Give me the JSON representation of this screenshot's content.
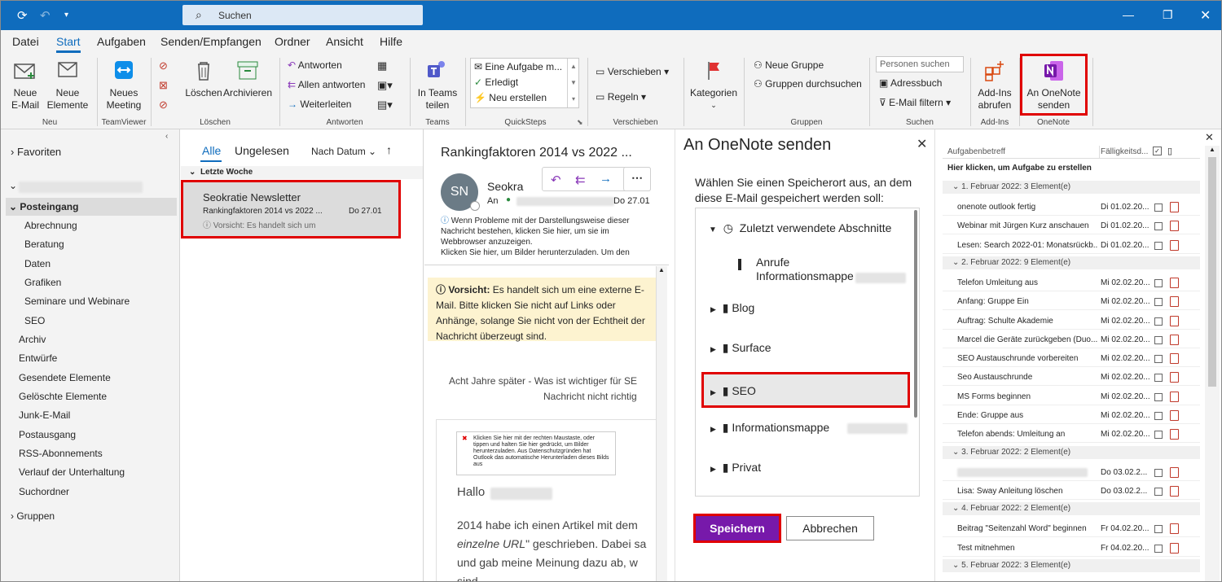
{
  "titlebar": {
    "search_placeholder": "Suchen"
  },
  "menu": {
    "tabs": [
      "Datei",
      "Start",
      "Aufgaben",
      "Senden/Empfangen",
      "Ordner",
      "Ansicht",
      "Hilfe"
    ]
  },
  "ribbon": {
    "neu": {
      "new_mail": "Neue\nE-Mail",
      "new_items": "Neue\nElemente",
      "label": "Neu"
    },
    "teamviewer": {
      "meeting": "Neues\nMeeting",
      "label": "TeamViewer"
    },
    "loeschen": {
      "delete": "Löschen",
      "archive": "Archivieren",
      "label": "Löschen"
    },
    "antworten": {
      "reply": "Antworten",
      "reply_all": "Allen antworten",
      "forward": "Weiterleiten",
      "label": "Antworten"
    },
    "teams": {
      "share": "In Teams\nteilen",
      "label": "Teams"
    },
    "quicksteps": {
      "items": [
        "Eine Aufgabe m...",
        "Erledigt",
        "Neu erstellen"
      ],
      "label": "QuickSteps"
    },
    "verschieben": {
      "move": "Verschieben",
      "rules": "Regeln",
      "label": "Verschieben"
    },
    "kategorien": {
      "label": "Kategorien"
    },
    "gruppen": {
      "new_group": "Neue Gruppe",
      "browse": "Gruppen durchsuchen",
      "label": "Gruppen"
    },
    "suchen": {
      "people_placeholder": "Personen suchen",
      "address_book": "Adressbuch",
      "filter": "E-Mail filtern",
      "label": "Suchen"
    },
    "addins": {
      "get": "Add-Ins\nabrufen",
      "label": "Add-Ins"
    },
    "onenote": {
      "send": "An OneNote\nsenden",
      "label": "OneNote"
    }
  },
  "folders": {
    "favorites": "Favoriten",
    "inbox": "Posteingang",
    "subfolders": [
      "Abrechnung",
      "Beratung",
      "Daten",
      "Grafiken",
      "Seminare und Webinare",
      "SEO"
    ],
    "others": [
      "Archiv",
      "Entwürfe",
      "Gesendete Elemente",
      "Gelöschte Elemente",
      "Junk-E-Mail",
      "Postausgang",
      "RSS-Abonnements",
      "Verlauf der Unterhaltung",
      "Suchordner"
    ],
    "groups": "Gruppen"
  },
  "messagelist": {
    "filter_all": "Alle",
    "filter_unread": "Ungelesen",
    "sort": "Nach Datum",
    "section": "Letzte Woche",
    "message": {
      "sender": "Seokratie Newsletter",
      "subject": "Rankingfaktoren 2014 vs 2022 ...",
      "date": "Do 27.01",
      "preview": "Vorsicht: Es handelt sich um"
    }
  },
  "reading": {
    "subject": "Rankingfaktoren 2014 vs 2022 ...",
    "initials": "SN",
    "sender": "Seokra",
    "to_label": "An",
    "date": "Do 27.01",
    "info": "Wenn Probleme mit der Darstellungsweise dieser Nachricht bestehen, klicken Sie hier, um sie im Webbrowser anzuzeigen.",
    "info2": "Klicken Sie hier, um Bilder herunterzuladen. Um den",
    "warning_bold": "Vorsicht:",
    "warning": " Es handelt sich um eine externe E-Mail. Bitte klicken Sie nicht auf Links oder Anhänge, solange Sie nicht von der Echtheit der Nachricht überzeugt sind.",
    "teaser1": "Acht Jahre später - Was ist wichtiger für SE",
    "teaser2": "Nachricht nicht richtig",
    "img_notice": "Klicken Sie hier mit der rechten Maustaste, oder tippen und halten Sie hier gedrückt, um Bilder herunterzuladen. Aus Datenschutzgründen hat Outlook das automatische Herunterladen dieses Bilds aus",
    "hallo": "Hallo",
    "body1": "2014 habe ich einen Artikel mit dem",
    "body2a": "einzelne URL",
    "body2b": "\" geschrieben. Dabei sa",
    "body3": "und gab meine Meinung dazu ab, w",
    "body4": "sind."
  },
  "onenote_panel": {
    "title": "An OneNote senden",
    "description": "Wählen Sie einen Speicherort aus, an dem diese E-Mail gespeichert werden soll:",
    "recent": "Zuletzt verwendete Abschnitte",
    "recent_item1": "Anrufe",
    "recent_item2": "Informationsmappe",
    "notebooks": [
      "Blog",
      "Surface",
      "SEO",
      "Informationsmappe",
      "Privat"
    ],
    "save": "Speichern",
    "cancel": "Abbrechen"
  },
  "tasks": {
    "col_subject": "Aufgabenbetreff",
    "col_due": "Fälligkeitsd...",
    "new_task": "Hier klicken, um Aufgabe zu erstellen",
    "groups": [
      {
        "header": "1. Februar 2022: 3 Element(e)",
        "items": [
          [
            "onenote outlook fertig",
            "Di 01.02.20..."
          ],
          [
            "Webinar mit Jürgen Kurz anschauen",
            "Di 01.02.20..."
          ],
          [
            "Lesen: Search 2022-01: Monatsrückb...",
            "Di 01.02.20..."
          ]
        ]
      },
      {
        "header": "2. Februar 2022: 9 Element(e)",
        "items": [
          [
            "Telefon Umleitung aus",
            "Mi 02.02.20..."
          ],
          [
            "Anfang: Gruppe Ein",
            "Mi 02.02.20..."
          ],
          [
            "Auftrag: Schulte Akademie",
            "Mi 02.02.20..."
          ],
          [
            "Marcel die Geräte zurückgeben (Duo...",
            "Mi 02.02.20..."
          ],
          [
            "SEO Austauschrunde vorbereiten",
            "Mi 02.02.20..."
          ],
          [
            "Seo Austauschrunde",
            "Mi 02.02.20..."
          ],
          [
            "MS Forms beginnen",
            "Mi 02.02.20..."
          ],
          [
            "Ende: Gruppe aus",
            "Mi 02.02.20..."
          ],
          [
            "Telefon abends: Umleitung an",
            "Mi 02.02.20..."
          ]
        ]
      },
      {
        "header": "3. Februar 2022: 2 Element(e)",
        "items": [
          [
            "",
            "Do 03.02.2..."
          ],
          [
            "Lisa: Sway Anleitung löschen",
            "Do 03.02.2..."
          ]
        ]
      },
      {
        "header": "4. Februar 2022: 2 Element(e)",
        "items": [
          [
            "Beitrag \"Seitenzahl Word\" beginnen",
            "Fr 04.02.20..."
          ],
          [
            "Test mitnehmen",
            "Fr 04.02.20..."
          ]
        ]
      },
      {
        "header": "5. Februar 2022: 3 Element(e)",
        "items": []
      }
    ]
  }
}
